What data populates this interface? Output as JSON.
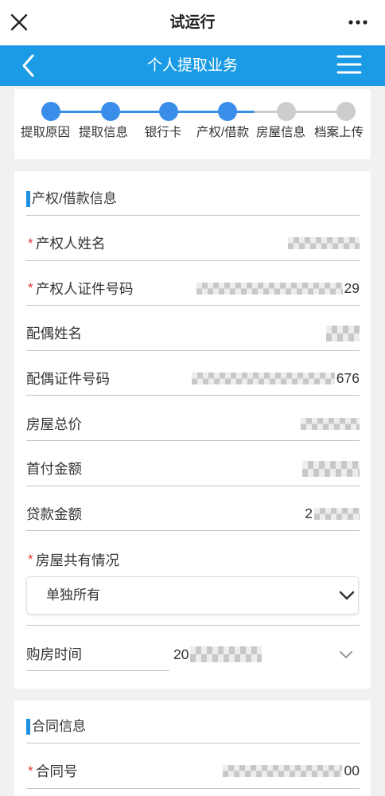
{
  "top_bar": {
    "title": "试运行",
    "close_icon": "close-icon",
    "more_icon": "more-icon"
  },
  "header": {
    "title": "个人提取业务",
    "back_icon": "chevron-left-icon",
    "menu_icon": "hamburger-menu-icon",
    "background_color": "#1b9be6"
  },
  "stepper": {
    "active_color": "#3a8de9",
    "inactive_color": "#cdcdcd",
    "steps": [
      {
        "label": "提取原因",
        "completed": true,
        "current": false
      },
      {
        "label": "提取信息",
        "completed": true,
        "current": false
      },
      {
        "label": "银行卡",
        "completed": true,
        "current": false
      },
      {
        "label": "产权/借款",
        "completed": false,
        "current": true
      },
      {
        "label": "房屋信息",
        "completed": false,
        "current": false
      },
      {
        "label": "档案上传",
        "completed": false,
        "current": false
      }
    ]
  },
  "form": {
    "required_mark": "*",
    "required_color": "#e53935",
    "section_accent_color": "#1e8fe1",
    "property_section": {
      "title": "产权/借款信息",
      "fields": [
        {
          "label": "产权人姓名",
          "required": true,
          "masked": true
        },
        {
          "label": "产权人证件号码",
          "required": true,
          "masked": true,
          "value_suffix": "29"
        },
        {
          "label": "配偶姓名",
          "required": false,
          "masked": true
        },
        {
          "label": "配偶证件号码",
          "required": false,
          "masked": true,
          "value_suffix": "676"
        },
        {
          "label": "房屋总价",
          "required": false,
          "masked": true
        },
        {
          "label": "首付金额",
          "required": false,
          "masked": true
        },
        {
          "label": "贷款金额",
          "required": false,
          "masked": true,
          "value_prefix": "2"
        }
      ],
      "co_ownership": {
        "label": "房屋共有情况",
        "required": true,
        "selected": "单独所有",
        "dropdown_icon": "chevron-down-icon"
      },
      "purchase_time": {
        "label": "购房时间",
        "required": false,
        "masked": true,
        "value_prefix": "20",
        "dropdown_icon": "chevron-down-icon"
      }
    },
    "contract_section": {
      "title": "合同信息",
      "fields": [
        {
          "label": "合同号",
          "required": true,
          "masked": true,
          "value_suffix": "00"
        }
      ]
    }
  }
}
